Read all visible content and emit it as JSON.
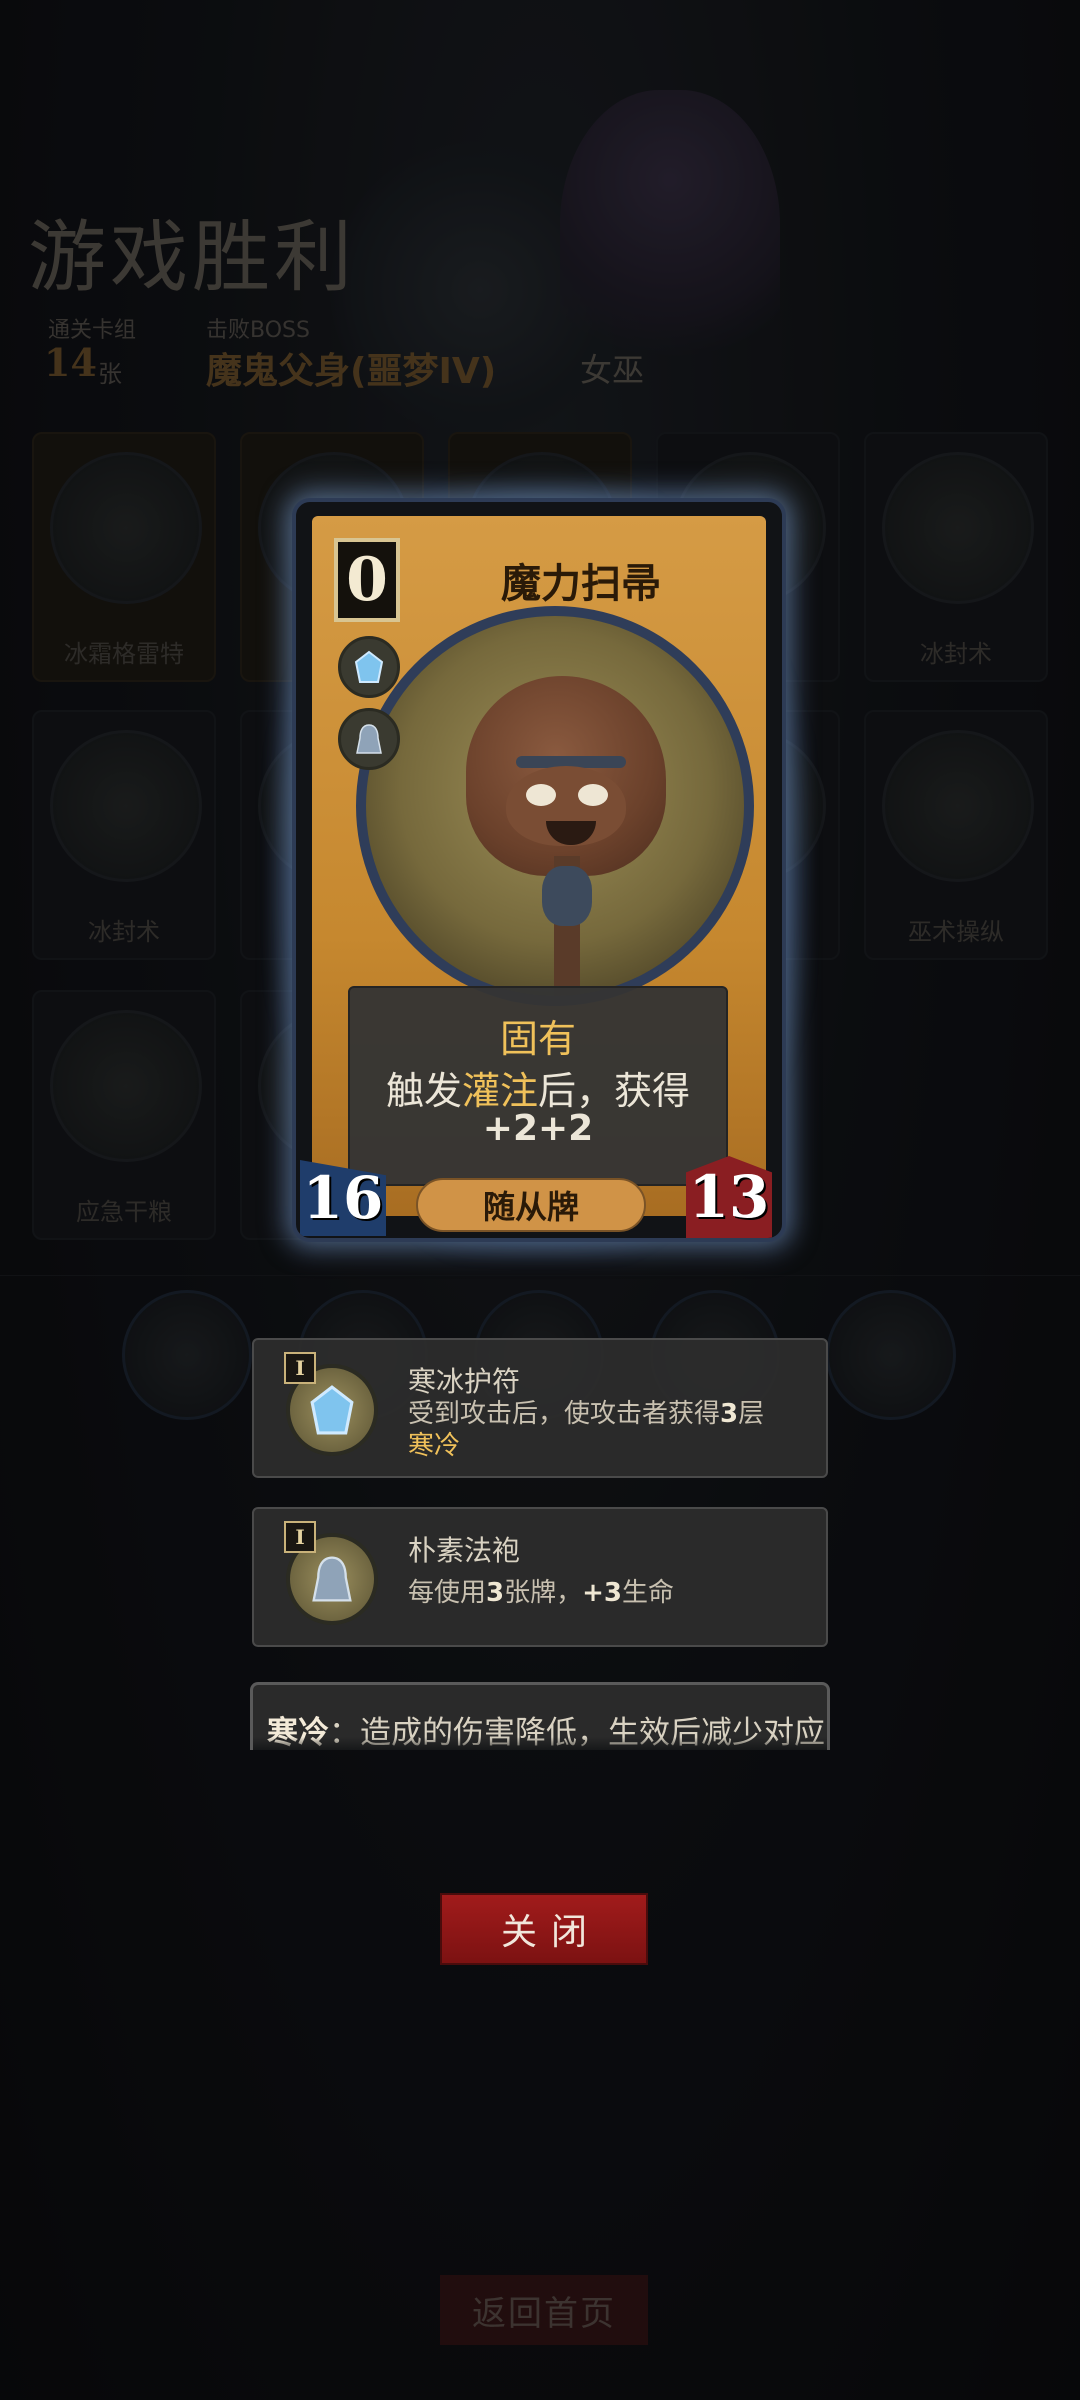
{
  "background": {
    "title": "游戏胜利",
    "deck_label": "通关卡组",
    "deck_count": "14",
    "deck_unit": "张",
    "boss_label": "击败BOSS",
    "boss_name": "魔鬼父身(噩梦IV)",
    "character": "女巫",
    "cards": [
      {
        "label": "冰霜格雷特"
      },
      {
        "label": ""
      },
      {
        "label": ""
      },
      {
        "label": ""
      },
      {
        "label": "冰封术"
      },
      {
        "label": "冰封术"
      },
      {
        "label": ""
      },
      {
        "label": ""
      },
      {
        "label": ""
      },
      {
        "label": "巫术操纵"
      },
      {
        "label": "应急干粮"
      },
      {
        "label": ""
      }
    ],
    "return_button": "返回首页"
  },
  "card": {
    "cost": "0",
    "name": "魔力扫帚",
    "keyword": "固有",
    "desc_prefix": "触发",
    "desc_highlight": "灌注",
    "desc_suffix": "后，获得",
    "desc_line2": "+2+2",
    "attack": "16",
    "health": "13",
    "type": "随从牌",
    "slot_icons": [
      "ice-amulet-icon",
      "robe-icon"
    ]
  },
  "tooltips": [
    {
      "badge": "I",
      "title": "寒冰护符",
      "desc_part1": "受到攻击后，使攻击者获得",
      "desc_bold": "3",
      "desc_part2": "层",
      "desc_keyword": "寒冷",
      "icon": "ice-amulet-icon"
    },
    {
      "badge": "I",
      "title": "朴素法袍",
      "desc_part1": "每使用",
      "desc_bold": "3",
      "desc_part2": "张牌，",
      "desc_bold2": "+3",
      "desc_part3": "生命",
      "icon": "robe-icon"
    }
  ],
  "glossary": {
    "term": "寒冷",
    "separator": "：",
    "text": "造成的伤害降低，生效后减少对应"
  },
  "close_button": "关闭",
  "colors": {
    "accent_gold": "#f0c15a",
    "card_frame": "#d59b45",
    "close_red": "#a11b1b",
    "attack_blue": "#1f3d6b",
    "health_red": "#8a1e22"
  }
}
